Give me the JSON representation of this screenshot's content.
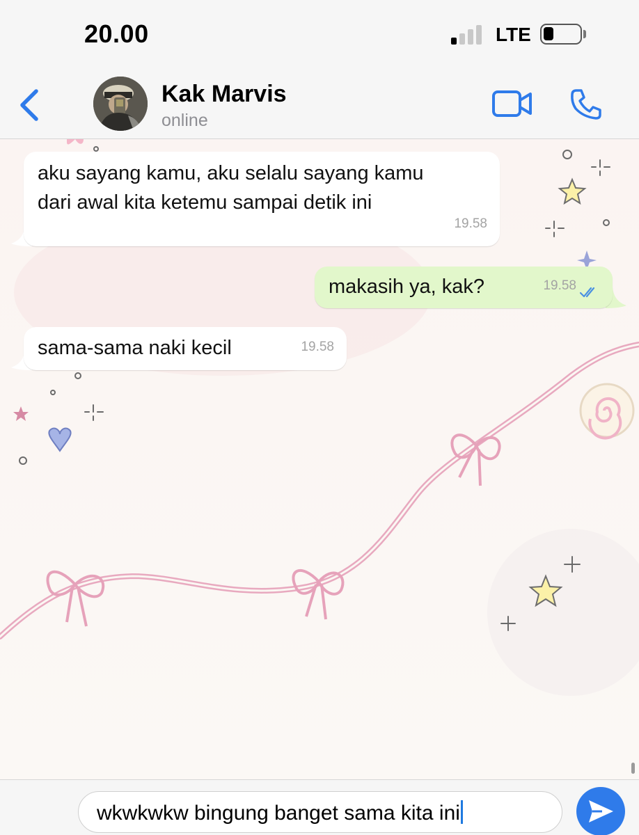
{
  "status_bar": {
    "time": "20.00",
    "network": "LTE"
  },
  "header": {
    "back_icon": "chevron-left-icon",
    "contact_name": "Kak Marvis",
    "contact_status": "online",
    "video_icon": "video-camera-icon",
    "call_icon": "phone-icon",
    "accent_color": "#2f7bea"
  },
  "messages": [
    {
      "direction": "incoming",
      "lines": [
        "aku sayang kamu, aku selalu sayang kamu",
        "dari awal kita ketemu sampai detik ini"
      ],
      "time": "19.58"
    },
    {
      "direction": "outgoing",
      "text": "makasih ya, kak?",
      "time": "19.58",
      "status": "read"
    },
    {
      "direction": "incoming",
      "text": "sama-sama naki kecil",
      "time": "19.58"
    }
  ],
  "input": {
    "value": "wkwkwkw bingung banget sama kita ini",
    "send_icon": "send-arrow-icon"
  },
  "colors": {
    "incoming_bubble": "#ffffff",
    "outgoing_bubble": "#e2f7cb",
    "read_ticks": "#4a90e2"
  }
}
